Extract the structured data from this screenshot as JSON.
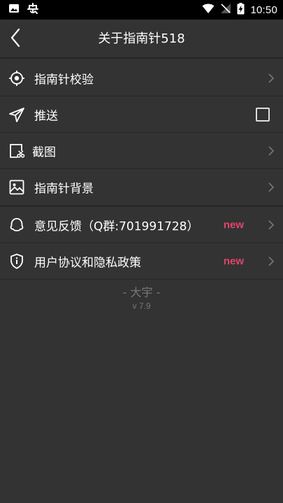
{
  "status_bar": {
    "time": "10:50",
    "left_icons": [
      "image-icon",
      "bug-icon"
    ],
    "right_icons": [
      "wifi-icon",
      "signal-off-icon",
      "battery-charging-icon"
    ]
  },
  "header": {
    "title": "关于指南针518",
    "back_icon": "back-arrow-icon"
  },
  "menu": {
    "items": [
      {
        "label": "指南针校验",
        "icon": "crosshair-icon",
        "accessory": "chevron"
      },
      {
        "label": "推送",
        "icon": "send-icon",
        "accessory": "checkbox",
        "checked": false
      },
      {
        "label": "截图",
        "icon": "screenshot-icon",
        "accessory": "chevron"
      },
      {
        "label": "指南针背景",
        "icon": "picture-icon",
        "accessory": "chevron"
      },
      {
        "label": "意见反馈（Q群:701991728）",
        "icon": "feedback-icon",
        "accessory": "chevron",
        "badge": "new"
      },
      {
        "label": "用户协议和隐私政策",
        "icon": "shield-icon",
        "accessory": "chevron",
        "badge": "new"
      }
    ]
  },
  "footer": {
    "author": "- 大宇 -",
    "version": "v 7.9"
  },
  "colors": {
    "background": "#333333",
    "divider": "#262626",
    "badge": "#e2456a",
    "muted_text": "#777777"
  }
}
